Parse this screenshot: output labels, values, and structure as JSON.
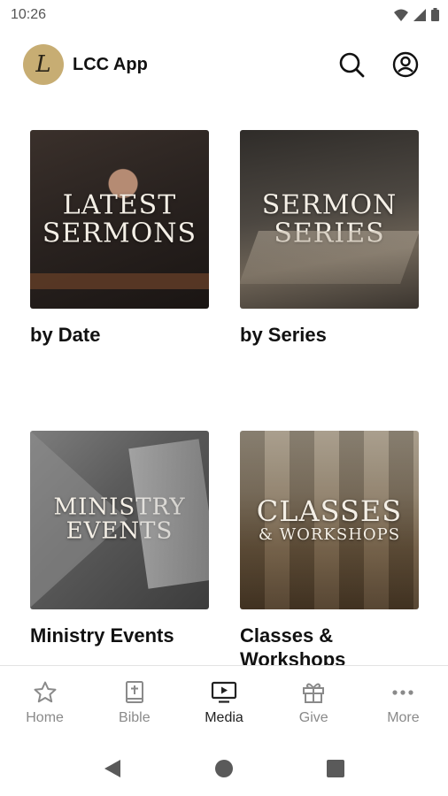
{
  "status": {
    "time": "10:26"
  },
  "header": {
    "app_name": "LCC App",
    "logo_letter": "L"
  },
  "tiles": [
    {
      "overlay_line1": "Latest",
      "overlay_line2": "Sermons",
      "caption": "by Date"
    },
    {
      "overlay_line1": "Sermon",
      "overlay_line2": "Series",
      "caption": "by Series"
    },
    {
      "overlay_line1": "Ministry",
      "overlay_line2": "Events",
      "caption": "Ministry Events"
    },
    {
      "overlay_line1": "Classes",
      "overlay_line2": "& Workshops",
      "caption": "Classes & Workshops"
    }
  ],
  "bottom_nav": {
    "items": [
      {
        "label": "Home",
        "icon": "star-icon",
        "active": false
      },
      {
        "label": "Bible",
        "icon": "bible-icon",
        "active": false
      },
      {
        "label": "Media",
        "icon": "media-icon",
        "active": true
      },
      {
        "label": "Give",
        "icon": "gift-icon",
        "active": false
      },
      {
        "label": "More",
        "icon": "more-icon",
        "active": false
      }
    ]
  },
  "colors": {
    "logo_bg": "#c7ad73",
    "active_label": "#222222",
    "inactive_label": "#8a8a8a"
  }
}
